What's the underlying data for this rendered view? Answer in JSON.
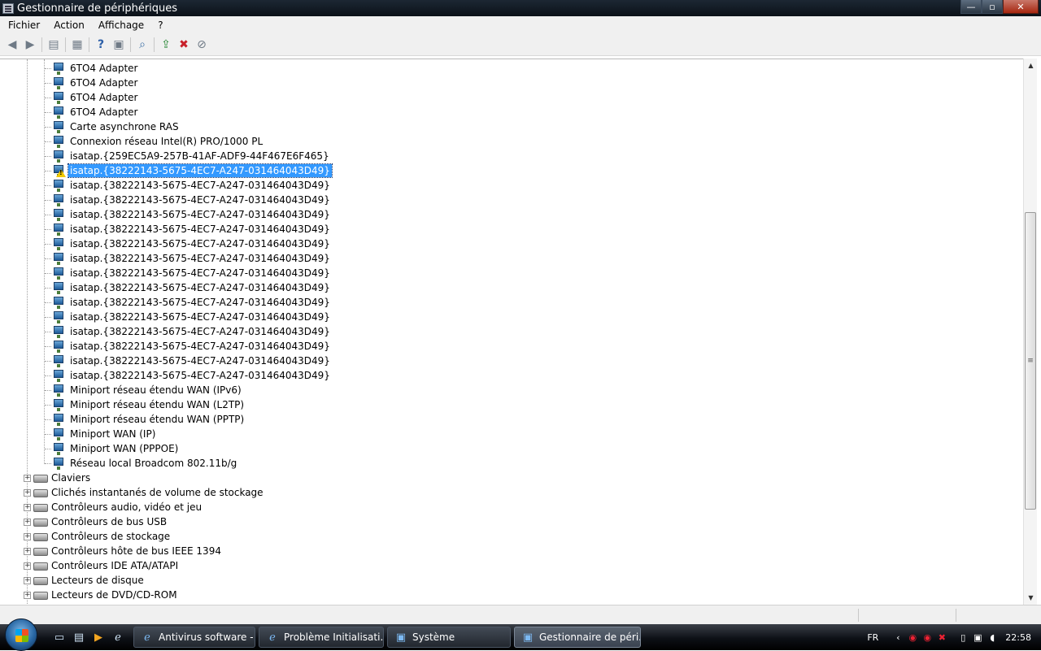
{
  "window": {
    "title": "Gestionnaire de périphériques",
    "min": "—",
    "max": "▫",
    "close": "✕"
  },
  "menu": [
    "Fichier",
    "Action",
    "Affichage",
    "?"
  ],
  "toolbar": {
    "back": "back-arrow-icon",
    "forward": "forward-arrow-icon"
  },
  "devices": [
    {
      "label": "6TO4 Adapter",
      "warn": false,
      "selected": false
    },
    {
      "label": "6TO4 Adapter",
      "warn": false,
      "selected": false
    },
    {
      "label": "6TO4 Adapter",
      "warn": false,
      "selected": false
    },
    {
      "label": "6TO4 Adapter",
      "warn": false,
      "selected": false
    },
    {
      "label": "Carte asynchrone RAS",
      "warn": false,
      "selected": false
    },
    {
      "label": "Connexion réseau Intel(R) PRO/1000 PL",
      "warn": false,
      "selected": false
    },
    {
      "label": "isatap.{259EC5A9-257B-41AF-ADF9-44F467E6F465}",
      "warn": false,
      "selected": false
    },
    {
      "label": "isatap.{38222143-5675-4EC7-A247-031464043D49}",
      "warn": true,
      "selected": true
    },
    {
      "label": "isatap.{38222143-5675-4EC7-A247-031464043D49}",
      "warn": false,
      "selected": false
    },
    {
      "label": "isatap.{38222143-5675-4EC7-A247-031464043D49}",
      "warn": false,
      "selected": false
    },
    {
      "label": "isatap.{38222143-5675-4EC7-A247-031464043D49}",
      "warn": false,
      "selected": false
    },
    {
      "label": "isatap.{38222143-5675-4EC7-A247-031464043D49}",
      "warn": false,
      "selected": false
    },
    {
      "label": "isatap.{38222143-5675-4EC7-A247-031464043D49}",
      "warn": false,
      "selected": false
    },
    {
      "label": "isatap.{38222143-5675-4EC7-A247-031464043D49}",
      "warn": false,
      "selected": false
    },
    {
      "label": "isatap.{38222143-5675-4EC7-A247-031464043D49}",
      "warn": false,
      "selected": false
    },
    {
      "label": "isatap.{38222143-5675-4EC7-A247-031464043D49}",
      "warn": false,
      "selected": false
    },
    {
      "label": "isatap.{38222143-5675-4EC7-A247-031464043D49}",
      "warn": false,
      "selected": false
    },
    {
      "label": "isatap.{38222143-5675-4EC7-A247-031464043D49}",
      "warn": false,
      "selected": false
    },
    {
      "label": "isatap.{38222143-5675-4EC7-A247-031464043D49}",
      "warn": false,
      "selected": false
    },
    {
      "label": "isatap.{38222143-5675-4EC7-A247-031464043D49}",
      "warn": false,
      "selected": false
    },
    {
      "label": "isatap.{38222143-5675-4EC7-A247-031464043D49}",
      "warn": false,
      "selected": false
    },
    {
      "label": "isatap.{38222143-5675-4EC7-A247-031464043D49}",
      "warn": false,
      "selected": false
    },
    {
      "label": "Miniport réseau étendu WAN (IPv6)",
      "warn": false,
      "selected": false
    },
    {
      "label": "Miniport réseau étendu WAN (L2TP)",
      "warn": false,
      "selected": false
    },
    {
      "label": "Miniport réseau étendu WAN (PPTP)",
      "warn": false,
      "selected": false
    },
    {
      "label": "Miniport WAN (IP)",
      "warn": false,
      "selected": false
    },
    {
      "label": "Miniport WAN (PPPOE)",
      "warn": false,
      "selected": false
    },
    {
      "label": "Réseau local Broadcom 802.11b/g",
      "warn": false,
      "selected": false
    }
  ],
  "categories": [
    {
      "label": "Claviers",
      "icon": "keyboard-icon"
    },
    {
      "label": "Clichés instantanés de volume de stockage",
      "icon": "storage-snapshot-icon"
    },
    {
      "label": "Contrôleurs audio, vidéo et jeu",
      "icon": "speaker-icon"
    },
    {
      "label": "Contrôleurs de bus USB",
      "icon": "usb-icon"
    },
    {
      "label": "Contrôleurs de stockage",
      "icon": "storage-controller-icon"
    },
    {
      "label": "Contrôleurs hôte de bus IEEE 1394",
      "icon": "firewire-icon"
    },
    {
      "label": "Contrôleurs IDE ATA/ATAPI",
      "icon": "ide-icon"
    },
    {
      "label": "Lecteurs de disque",
      "icon": "disk-drive-icon"
    },
    {
      "label": "Lecteurs de DVD/CD-ROM",
      "icon": "dvd-drive-icon"
    }
  ],
  "expander": "+",
  "taskbar": {
    "tasks": [
      {
        "label": "Antivirus software - ...",
        "icon": "ie-icon",
        "active": false
      },
      {
        "label": "Problème Initialisati...",
        "icon": "ie-icon",
        "active": false
      },
      {
        "label": "Système",
        "icon": "system-icon",
        "active": false
      },
      {
        "label": "Gestionnaire de péri...",
        "icon": "device-manager-icon",
        "active": true
      }
    ],
    "lang": "FR",
    "clock": "22:58"
  }
}
